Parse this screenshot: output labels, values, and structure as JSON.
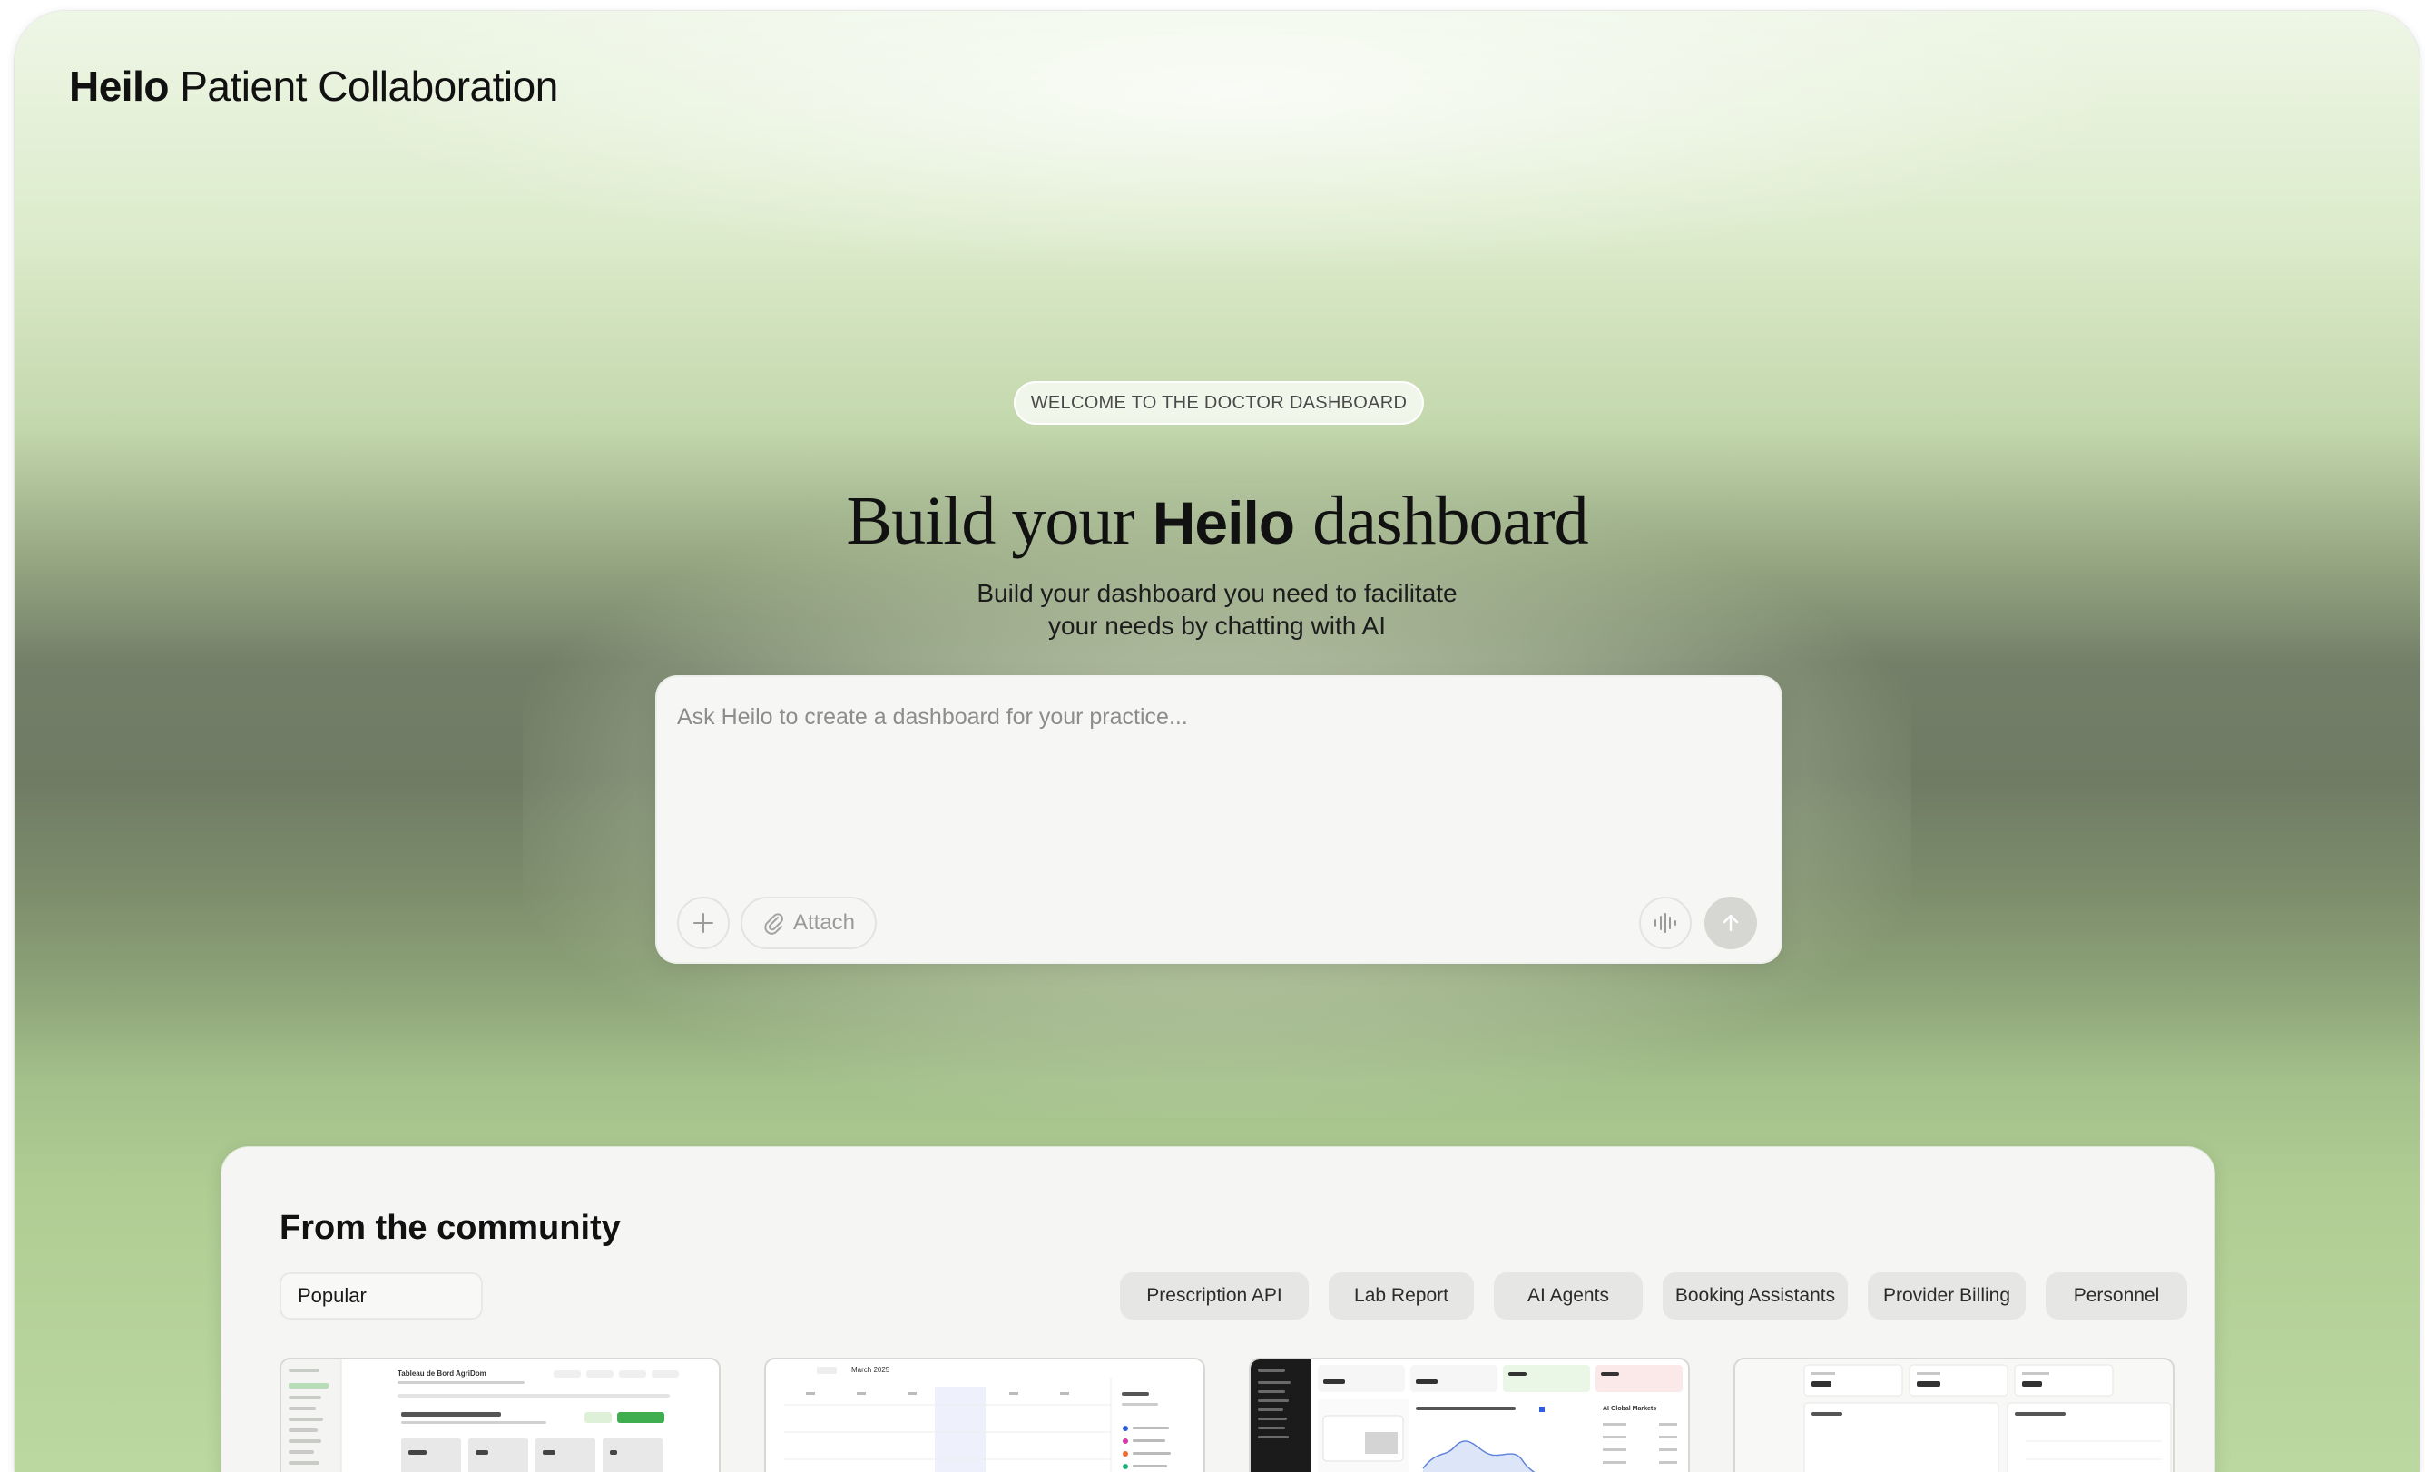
{
  "brand": {
    "strong": "Heilo",
    "rest": "Patient Collaboration"
  },
  "hero": {
    "badge": "WELCOME TO THE DOCTOR DASHBOARD",
    "headline_pre": "Build your",
    "headline_brand": "Heilo",
    "headline_post": "dashboard",
    "sub_line1": "Build your dashboard you need to facilitate",
    "sub_line2": "your needs by chatting with AI"
  },
  "prompt": {
    "placeholder": "Ask Heilo to create a dashboard for your practice...",
    "value": "",
    "attach_label": "Attach",
    "icons": {
      "add": "plus-icon",
      "attach": "paperclip-icon",
      "voice": "audio-waveform-icon",
      "send": "arrow-up-icon"
    }
  },
  "community": {
    "title": "From the community",
    "sort_value": "Popular",
    "categories": [
      "Prescription API",
      "Lab Report",
      "AI Agents",
      "Booking Assistants",
      "Provider Billing",
      "Personnel"
    ],
    "cards": [
      {
        "title": "Tableau de Bord AgriDom"
      },
      {
        "title": "March 2025"
      },
      {
        "title": "AI Global Markets"
      },
      {
        "title": ""
      }
    ]
  },
  "colors": {
    "accent_green": "#b7d49c",
    "deep_band": "#6f7b64",
    "chip_bg": "#e6e6e4",
    "send_disabled": "#d6d6d3"
  }
}
